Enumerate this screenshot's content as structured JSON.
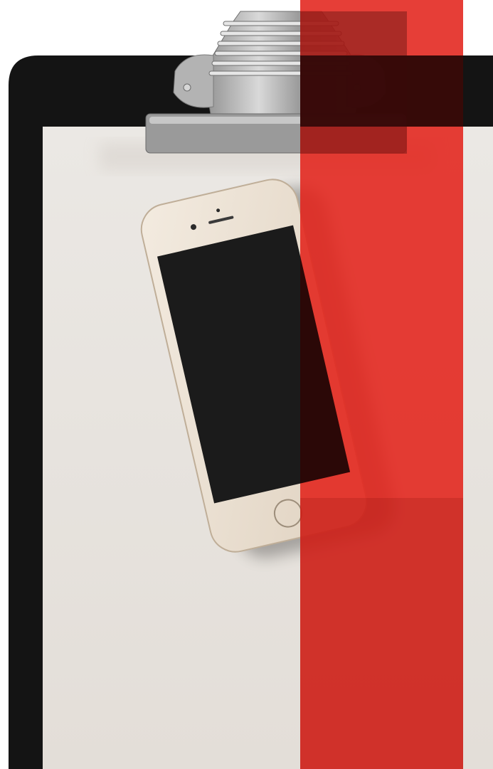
{
  "scene": {
    "subjects": [
      "clipboard",
      "smartphone",
      "red-overlay-stripe"
    ],
    "colors": {
      "background": "#ffffff",
      "clipboard_board": "#141414",
      "paper": "#e8e4df",
      "paper_shadow": "#d8d3cd",
      "clip_metal": "#a9a9a9",
      "clip_metal_dark": "#7a7a7a",
      "phone_body": "#ece1d3",
      "phone_bezel": "#cdbfae",
      "phone_screen": "#1b1b1b",
      "stripe_red": "#e3231b",
      "stripe_dark_overlap": "#1c0606"
    }
  }
}
